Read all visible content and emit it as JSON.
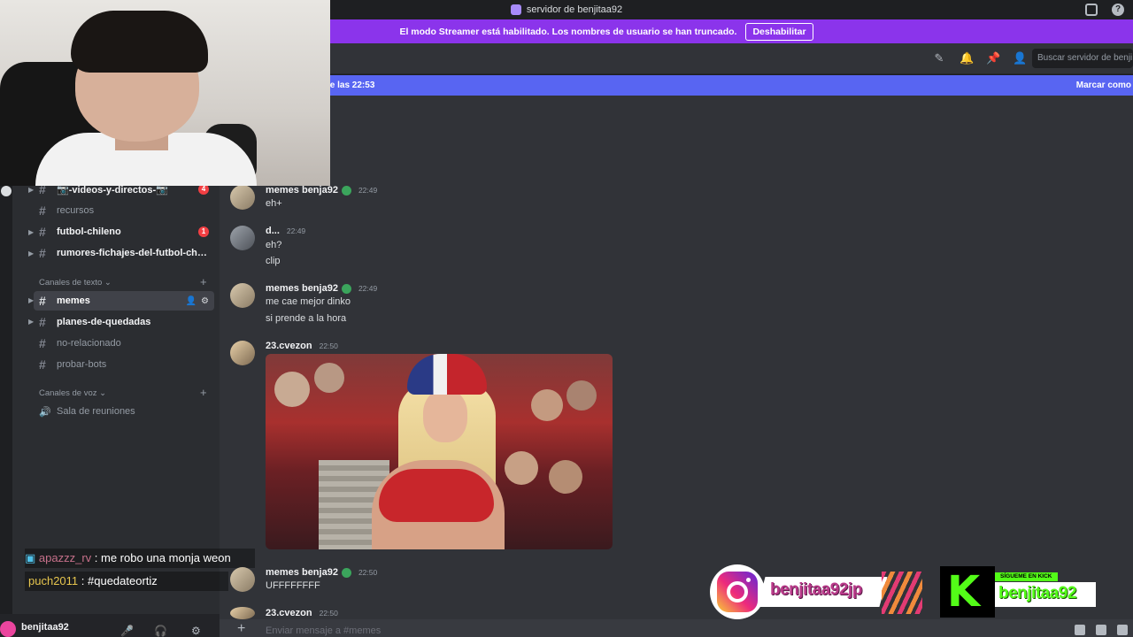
{
  "titlebar": {
    "server_name": "servidor de benjitaa92"
  },
  "streamer_banner": {
    "text": "El modo Streamer está habilitado. Los nombres de usuario se han truncado.",
    "button": "Deshabilitar"
  },
  "header": {
    "search_placeholder": "Buscar servidor de benji",
    "icons": [
      "threads-icon",
      "bell-icon",
      "pin-icon",
      "members-icon"
    ]
  },
  "new_messages": {
    "left": "le las 22:53",
    "right": "Marcar como"
  },
  "sidebar": {
    "channels": [
      {
        "name": "📷-videos-y-directos-📷",
        "badge": "4",
        "bold": true,
        "caret": true
      },
      {
        "name": "recursos",
        "badge": null,
        "bold": false,
        "caret": false
      },
      {
        "name": "futbol-chileno",
        "badge": "1",
        "bold": true,
        "caret": true
      },
      {
        "name": "rumores-fichajes-del-futbol-chi...",
        "badge": null,
        "bold": true,
        "caret": true
      }
    ],
    "text_category": "Canales de texto",
    "text_channels": [
      {
        "name": "memes",
        "active": true,
        "bold": true,
        "caret": true
      },
      {
        "name": "planes-de-quedadas",
        "active": false,
        "bold": true,
        "caret": true
      },
      {
        "name": "no-relacionado",
        "active": false,
        "bold": false,
        "caret": false
      },
      {
        "name": "probar-bots",
        "active": false,
        "bold": false,
        "caret": false
      }
    ],
    "voice_category": "Canales de voz",
    "voice_channels": [
      {
        "name": "Sala de reuniones"
      }
    ]
  },
  "stream_chat": [
    {
      "user": "apazzz_rv",
      "sep": " : ",
      "text": "me robo una monja weon"
    },
    {
      "user": "puch2011",
      "sep": " : ",
      "text": "#quedateortiz"
    }
  ],
  "user_panel": {
    "username": "benjitaa92"
  },
  "messages": [
    {
      "author": "memes benja92",
      "verified": true,
      "time": "22:49",
      "lines": [
        "eh+"
      ]
    },
    {
      "author": "d...",
      "verified": false,
      "time": "22:49",
      "lines": [
        "eh?",
        "clip"
      ]
    },
    {
      "author": "memes benja92",
      "verified": true,
      "time": "22:49",
      "lines": [
        "me cae mejor dinko",
        "si prende a la hora"
      ]
    },
    {
      "author": "23.cvezon",
      "verified": false,
      "time": "22:50",
      "lines": []
    },
    {
      "author": "memes benja92",
      "verified": true,
      "time": "22:50",
      "lines": [
        "UFFFFFFFF"
      ]
    },
    {
      "author": "23.cvezon",
      "verified": false,
      "time": "22:50",
      "lines": []
    }
  ],
  "input": {
    "placeholder": "Enviar mensaje a #memes"
  },
  "overlays": {
    "instagram_handle": "benjitaa92jp",
    "kick_tag": "SÍGUEME EN KICK",
    "kick_handle": "benjitaa92"
  },
  "colors": {
    "streamer_banner": "#8b34eb",
    "new_messages_bar": "#5865f2",
    "kick_green": "#53fc18",
    "badge_red": "#f23f43"
  }
}
